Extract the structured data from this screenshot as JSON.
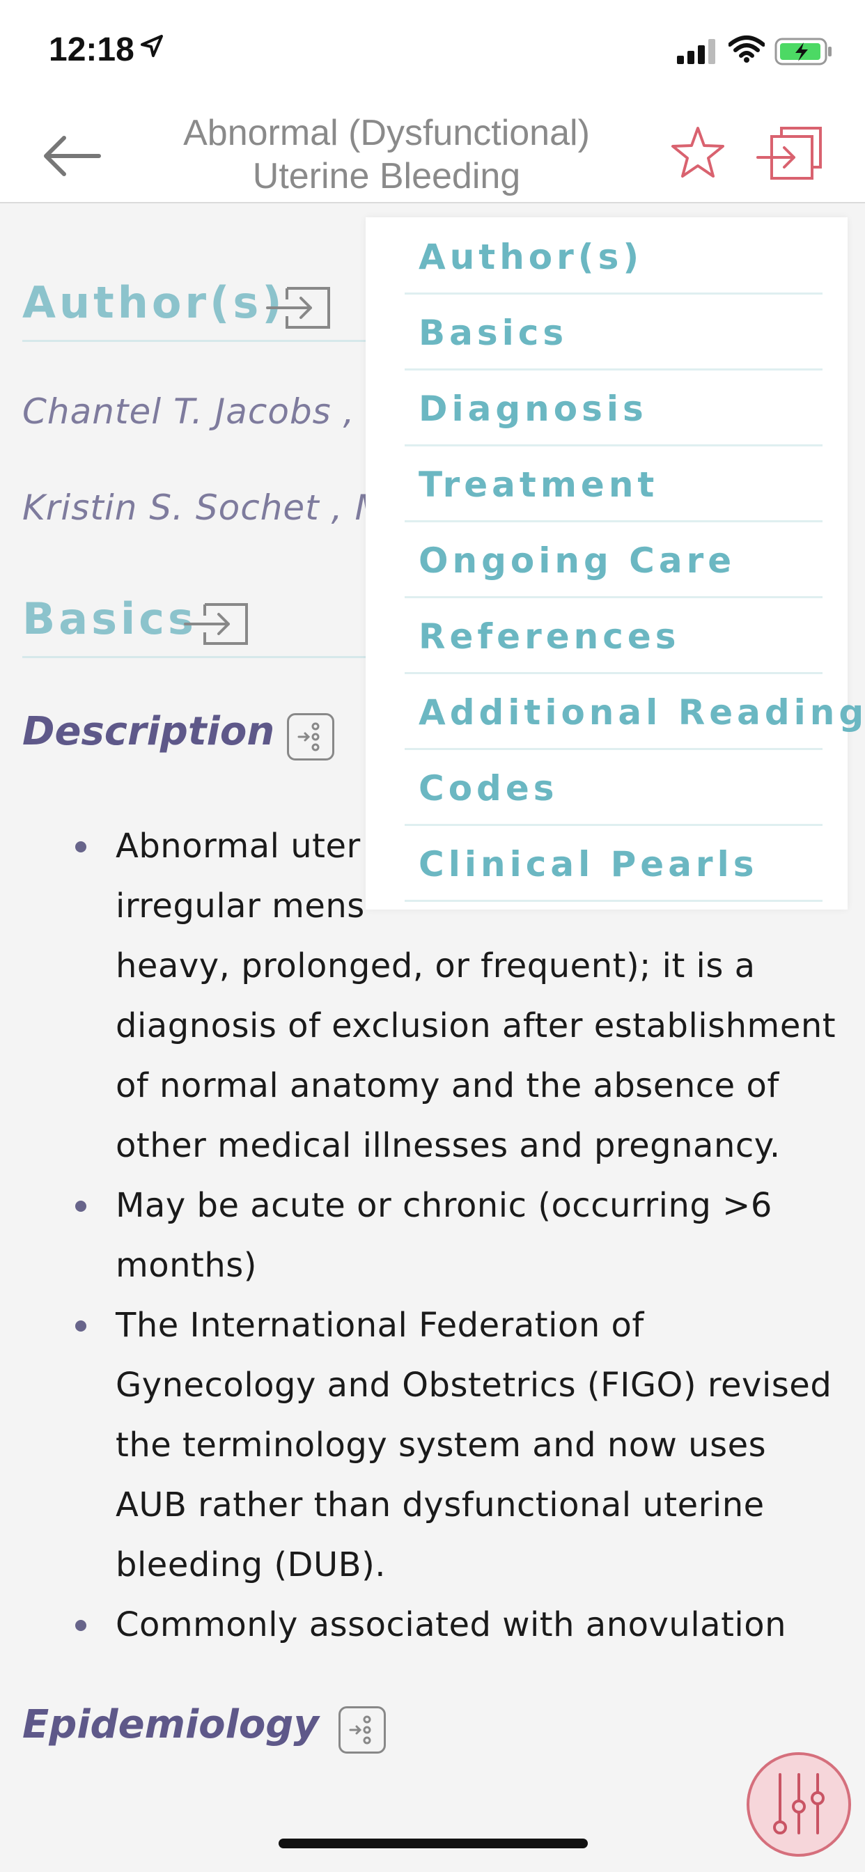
{
  "status_bar": {
    "time": "12:18"
  },
  "nav": {
    "title_line1": "Abnormal (Dysfunctional)",
    "title_line2": "Uterine Bleeding"
  },
  "sections": {
    "authors_heading": "Author(s)",
    "authors": [
      "Chantel T. Jacobs , M",
      "Kristin S. Sochet , ML"
    ],
    "basics_heading": "Basics",
    "description_heading": "Description",
    "epidemiology_heading": "Epidemiology"
  },
  "description_bullets": [
    "Abnormal uter",
    "May be acute or chronic (occurring >6 months)",
    "The International Federation of Gynecology and Obstetrics (FIGO) revised the terminology system and now uses AUB rather than dysfunctional uterine bleeding (DUB).",
    "Commonly associated with anovulation"
  ],
  "description_bullet1_lines": [
    "irregular mens",
    "heavy, prolonged, or frequent); it is a",
    "diagnosis of exclusion after establishment",
    "of normal anatomy and the absence of",
    "other medical illnesses and pregnancy."
  ],
  "dropdown": {
    "items": [
      "Author(s)",
      "Basics",
      "Diagnosis",
      "Treatment",
      "Ongoing Care",
      "References",
      "Additional Reading",
      "Codes",
      "Clinical Pearls"
    ]
  },
  "colors": {
    "accent_teal": "#6bb7c2",
    "section_heading": "#8cc3cc",
    "subheading_purple": "#5e5889",
    "icon_red": "#d56f7c"
  },
  "icons": [
    "location-arrow-icon",
    "signal-icon",
    "wifi-icon",
    "battery-icon",
    "back-arrow-icon",
    "star-icon",
    "jump-to-icon",
    "expand-icon",
    "filter-sliders-icon"
  ]
}
